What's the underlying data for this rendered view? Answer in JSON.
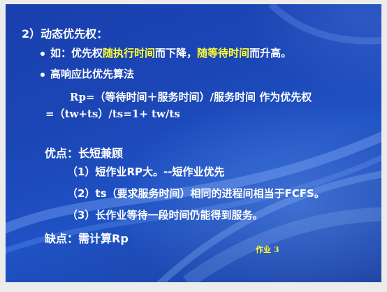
{
  "section_title": "2）动态优先权：",
  "bullet1": {
    "prefix": "如：优先权",
    "hl1": "随执行时间",
    "mid": "而下降，",
    "hl2": "随等待时间",
    "suffix": "而升高。"
  },
  "bullet2": {
    "text": "高响应比优先算法"
  },
  "formula_line1": "Rp=（等待时间＋服务时间）/服务时间  作为优先权",
  "formula_line2": "=（tw+ts）/ts=1+ tw/ts",
  "advantage_title": "优点：长短兼顾",
  "advantages": [
    "（1）短作业RP大。--短作业优先",
    "（2）ts（要求服务时间）相同的进程间相当于FCFS。",
    "（3）长作业等待一段时间仍能得到服务。"
  ],
  "disadvantage": "缺点：需计算Rp",
  "homework": "作业 3",
  "colors": {
    "background": "#1d4ab8",
    "text": "#ffffff",
    "highlight": "#ffff33"
  }
}
